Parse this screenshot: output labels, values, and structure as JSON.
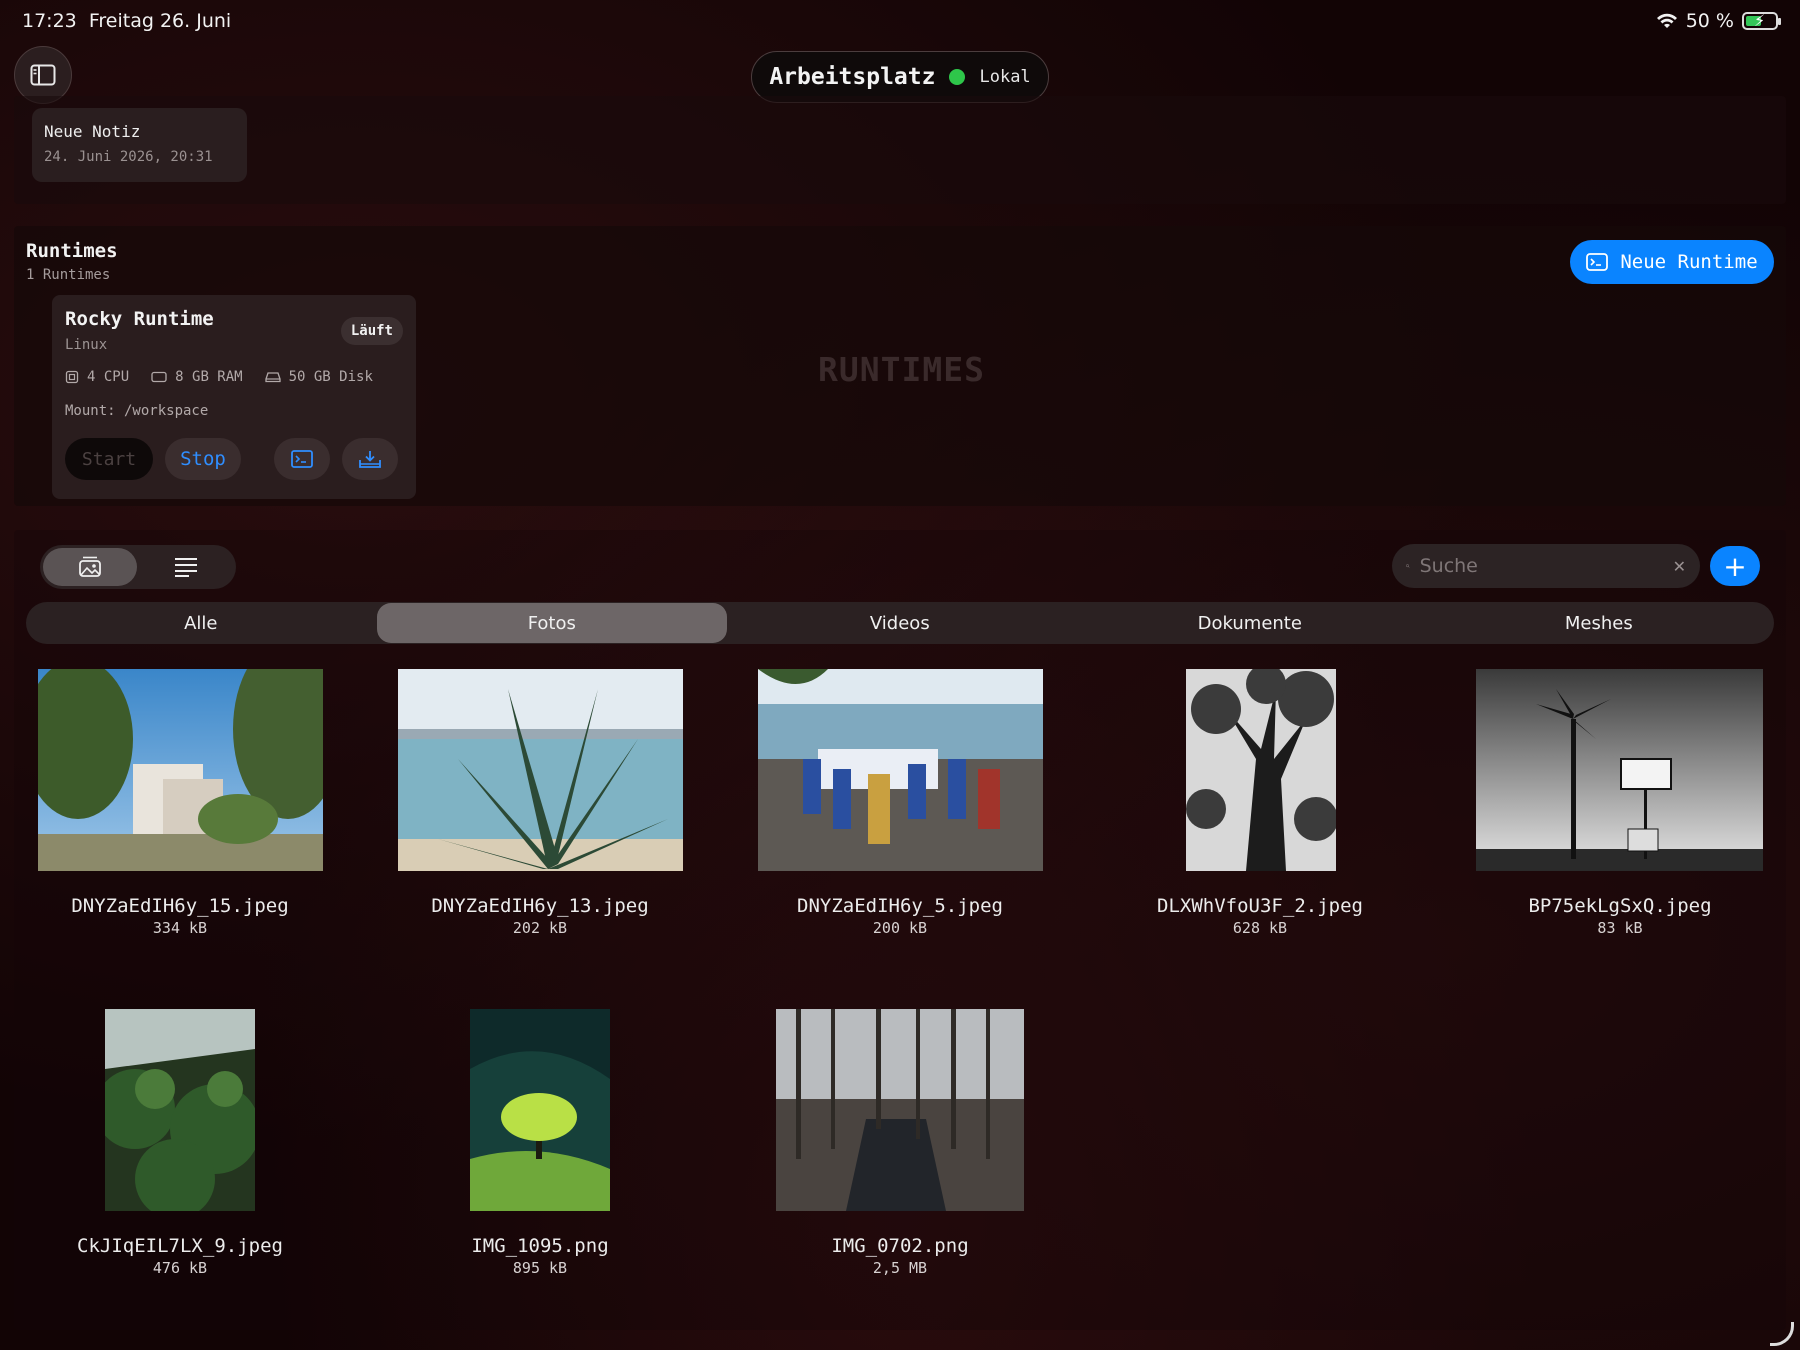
{
  "status": {
    "time": "17:23",
    "date": "Freitag 26. Juni",
    "battery": "50 %",
    "battery_level": 0.5
  },
  "header": {
    "title": "Arbeitsplatz",
    "location": "Lokal",
    "status_color": "#2ec64a"
  },
  "note": {
    "title": "Neue Notiz",
    "date": "24. Juni 2026, 20:31"
  },
  "runtimes": {
    "title": "Runtimes",
    "count": "1 Runtimes",
    "watermark": "RUNTIMES",
    "new_button": "Neue Runtime",
    "card": {
      "name": "Rocky Runtime",
      "os": "Linux",
      "status": "Läuft",
      "cpu": "4 CPU",
      "ram": "8 GB RAM",
      "disk": "50 GB Disk",
      "mount": "Mount: /workspace",
      "start_label": "Start",
      "stop_label": "Stop"
    }
  },
  "files": {
    "search_placeholder": "Suche",
    "tabs": [
      "Alle",
      "Fotos",
      "Videos",
      "Dokumente",
      "Meshes"
    ],
    "active_tab": "Fotos",
    "items": [
      {
        "name": "DNYZaEdIH6y_15.jpeg",
        "size": "334 kB",
        "icon": "park-buildings-photo"
      },
      {
        "name": "DNYZaEdIH6y_13.jpeg",
        "size": "202 kB",
        "icon": "palm-leaves-sea-photo"
      },
      {
        "name": "DNYZaEdIH6y_5.jpeg",
        "size": "200 kB",
        "icon": "seaside-tables-photo"
      },
      {
        "name": "DLXWhVfoU3F_2.jpeg",
        "size": "628 kB",
        "icon": "bw-tree-photo"
      },
      {
        "name": "BP75ekLgSxQ.jpeg",
        "size": "83 kB",
        "icon": "motel-sign-photo"
      },
      {
        "name": "CkJIqEIL7LX_9.jpeg",
        "size": "476 kB",
        "icon": "greenhouse-photo"
      },
      {
        "name": "IMG_1095.png",
        "size": "895 kB",
        "icon": "green-tree-hill-image"
      },
      {
        "name": "IMG_0702.png",
        "size": "2,5 MB",
        "icon": "swamp-forest-photo"
      }
    ]
  },
  "colors": {
    "accent": "#0a84ff",
    "background": "#120405"
  }
}
